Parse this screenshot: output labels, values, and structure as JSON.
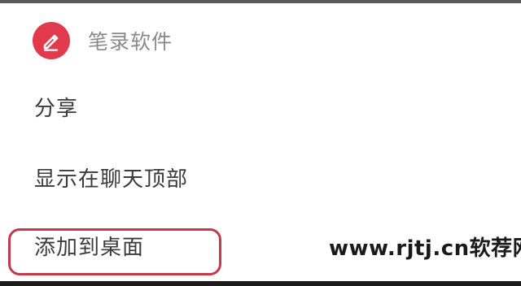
{
  "app": {
    "name": "笔录软件",
    "icon": "pencil-icon",
    "icon_color": "#e03a4c"
  },
  "menu": {
    "items": [
      {
        "label": "分享"
      },
      {
        "label": "显示在聊天顶部"
      },
      {
        "label": "添加到桌面"
      }
    ],
    "highlight_color": "#c23b4a"
  },
  "watermark": {
    "text": "www.rjtj.cn软荐网"
  }
}
